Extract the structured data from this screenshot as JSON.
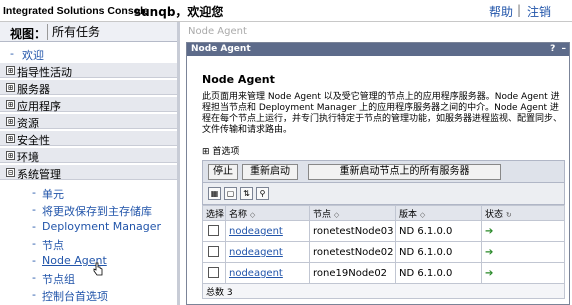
{
  "banner": {
    "product": "Integrated Solutions Console",
    "user_welcome": "sunqb，欢迎您",
    "help": "帮助",
    "separator": "|",
    "logout": "注销"
  },
  "nav": {
    "view_label": "视图：",
    "view_value": "所有任务",
    "welcome": "欢迎",
    "categories": [
      {
        "label": "指导性活动",
        "toggle": "⊞"
      },
      {
        "label": "服务器",
        "toggle": "⊞"
      },
      {
        "label": "应用程序",
        "toggle": "⊞"
      },
      {
        "label": "资源",
        "toggle": "⊞"
      },
      {
        "label": "安全性",
        "toggle": "⊞"
      },
      {
        "label": "环境",
        "toggle": "⊞"
      },
      {
        "label": "系统管理",
        "toggle": "⊟"
      }
    ],
    "system_admin_items": [
      "单元",
      "将更改保存到主存储库",
      "Deployment Manager",
      "节点",
      "Node Agent",
      "节点组",
      "控制台首选项"
    ]
  },
  "content": {
    "breadcrumb": "Node Agent",
    "portlet_title": "Node Agent",
    "portlet_controls": [
      "?",
      "–"
    ],
    "heading": "Node Agent",
    "description": "此页面用来管理 Node Agent 以及受它管理的节点上的应用程序服务器。Node Agent 进程担当节点和 Deployment Manager 上的应用程序服务器之间的中介。Node Agent 进程在每个节点上运行，并专门执行特定于节点的管理功能，如服务器进程监视、配置同步、文件传输和请求路由。",
    "preferences": "首选项",
    "buttons": [
      "停止",
      "重新启动",
      "重新启动节点上的所有服务器"
    ],
    "toolbar_icons": [
      "select-all-icon",
      "deselect-all-icon",
      "filter-icon",
      "clear-filter-icon"
    ],
    "table": {
      "headers": [
        "选择",
        "名称",
        "节点",
        "版本",
        "状态"
      ],
      "rows": [
        {
          "name": "nodeagent",
          "node": "ronetestNode03",
          "version": "ND 6.1.0.0",
          "status": "started"
        },
        {
          "name": "nodeagent",
          "node": "ronetestNode02",
          "version": "ND 6.1.0.0",
          "status": "started"
        },
        {
          "name": "nodeagent",
          "node": "rone19Node02",
          "version": "ND 6.1.0.0",
          "status": "started"
        }
      ],
      "total_label": "总数",
      "total": "3"
    }
  },
  "colors": {
    "link": "#2255aa",
    "title_bar": "#5d6b8a",
    "status_started": "#2a8a2a"
  }
}
